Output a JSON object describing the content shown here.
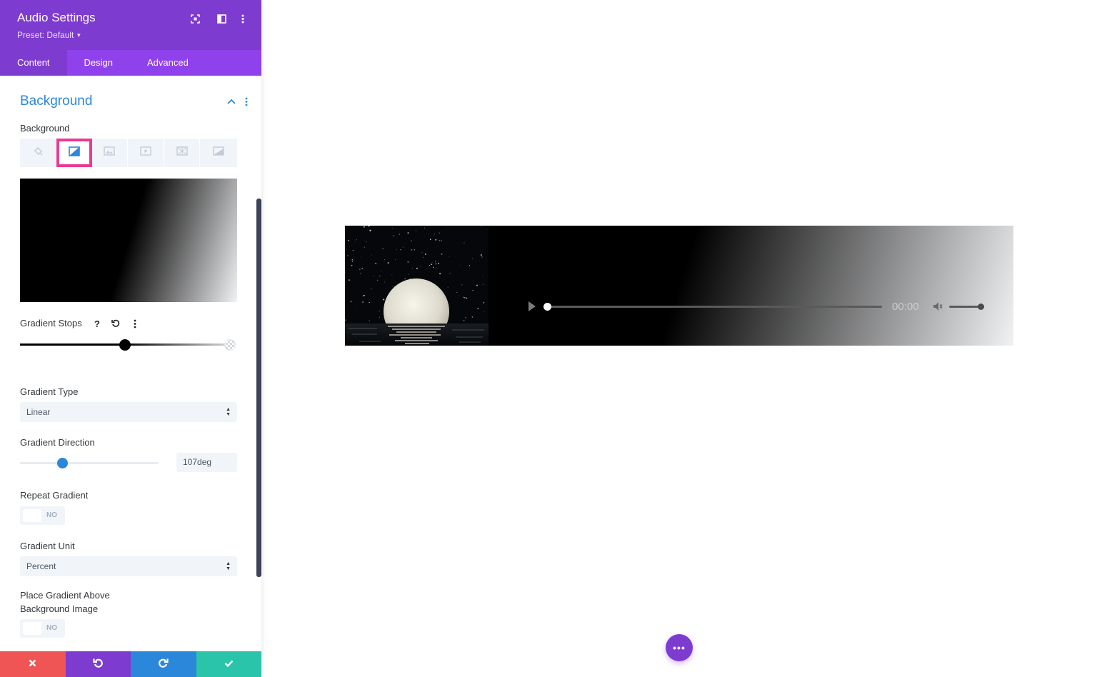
{
  "panel": {
    "title": "Audio Settings",
    "preset_label": "Preset: Default",
    "header_icons": [
      "expand-icon",
      "split-view-icon",
      "more-vertical-icon"
    ],
    "tabs": [
      {
        "label": "Content",
        "active": true
      },
      {
        "label": "Design",
        "active": false
      },
      {
        "label": "Advanced",
        "active": false
      }
    ]
  },
  "section": {
    "title": "Background",
    "expanded": true
  },
  "background": {
    "label": "Background",
    "types": [
      {
        "icon": "paint-bucket-icon",
        "active": false
      },
      {
        "icon": "gradient-icon",
        "active": true
      },
      {
        "icon": "image-icon",
        "active": false
      },
      {
        "icon": "video-icon",
        "active": false
      },
      {
        "icon": "pattern-icon",
        "active": false
      },
      {
        "icon": "mask-icon",
        "active": false
      }
    ],
    "highlight_color": "#ea3a92"
  },
  "gradient": {
    "stops_label": "Gradient Stops",
    "stops": [
      {
        "color": "#000000",
        "position_percent": 50
      },
      {
        "color": "#f1f2f4",
        "position_percent": 100
      }
    ],
    "type_label": "Gradient Type",
    "type_value": "Linear",
    "direction_label": "Gradient Direction",
    "direction_value": "107deg",
    "direction_degrees": 107,
    "repeat_label": "Repeat Gradient",
    "repeat_value": "NO",
    "unit_label": "Gradient Unit",
    "unit_value": "Percent",
    "above_image_label_line1": "Place Gradient Above",
    "above_image_label_line2": "Background Image",
    "above_image_value": "NO"
  },
  "footer": {
    "buttons": [
      {
        "name": "cancel",
        "icon": "close-icon",
        "color": "#ef5555"
      },
      {
        "name": "undo",
        "icon": "undo-icon",
        "color": "#7e3bd0"
      },
      {
        "name": "redo",
        "icon": "redo-icon",
        "color": "#2b87da"
      },
      {
        "name": "save",
        "icon": "check-icon",
        "color": "#29c4a9"
      }
    ]
  },
  "player": {
    "time": "00:00",
    "progress_fraction": 0,
    "volume_fraction": 0.9
  },
  "colors": {
    "header": "#7e3bd0",
    "tabs_bar": "#8f42ec",
    "accent_blue": "#2b87da"
  }
}
